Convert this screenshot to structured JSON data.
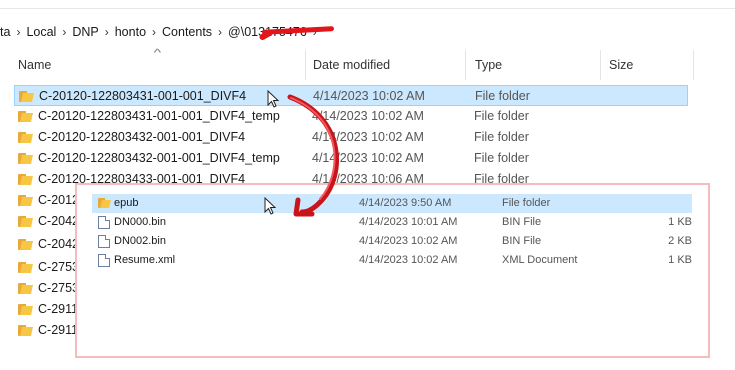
{
  "breadcrumb": {
    "items": [
      "ta",
      "Local",
      "DNP",
      "honto",
      "Contents",
      "@\\013175476"
    ],
    "separator": "›"
  },
  "columns": {
    "name": "Name",
    "date": "Date modified",
    "type": "Type",
    "size": "Size"
  },
  "files": [
    {
      "name": "C-20120-122803431-001-001_DIVF4",
      "date": "4/14/2023 10:02 AM",
      "type": "File folder",
      "selected": true
    },
    {
      "name": "C-20120-122803431-001-001_DIVF4_temp",
      "date": "4/14/2023 10:02 AM",
      "type": "File folder"
    },
    {
      "name": "C-20120-122803432-001-001_DIVF4",
      "date": "4/14/2023 10:02 AM",
      "type": "File folder"
    },
    {
      "name": "C-20120-122803432-001-001_DIVF4_temp",
      "date": "4/14/2023 10:02 AM",
      "type": "File folder"
    },
    {
      "name": "C-20120-122803433-001-001_DIVF4",
      "date": "4/14/2023 10:06 AM",
      "type": "File folder"
    },
    {
      "name": "C-2012",
      "date": "",
      "type": ""
    },
    {
      "name": "C-2042",
      "date": "",
      "type": ""
    },
    {
      "name": "C-2042",
      "date": "",
      "type": ""
    },
    {
      "name": "C-2753",
      "date": "",
      "type": ""
    },
    {
      "name": "C-2753",
      "date": "",
      "type": ""
    },
    {
      "name": "C-2911",
      "date": "",
      "type": ""
    },
    {
      "name": "C-2911",
      "date": "",
      "type": ""
    }
  ],
  "subfolder": {
    "items": [
      {
        "name": "epub",
        "date": "4/14/2023 9:50 AM",
        "type": "File folder",
        "size": "",
        "icon": "folder-icon",
        "selected": true
      },
      {
        "name": "DN000.bin",
        "date": "4/14/2023 10:01 AM",
        "type": "BIN File",
        "size": "1 KB",
        "icon": "file-icon"
      },
      {
        "name": "DN002.bin",
        "date": "4/14/2023 10:02 AM",
        "type": "BIN File",
        "size": "2 KB",
        "icon": "file-icon"
      },
      {
        "name": "Resume.xml",
        "date": "4/14/2023 10:02 AM",
        "type": "XML Document",
        "size": "1 KB",
        "icon": "file-icon"
      }
    ]
  },
  "colors": {
    "selection": "#cce8ff",
    "selection_border": "#99d1ff",
    "annotation_red": "#e2151b",
    "overlay_border": "#f4bcbc",
    "folder": "#f7c744"
  }
}
